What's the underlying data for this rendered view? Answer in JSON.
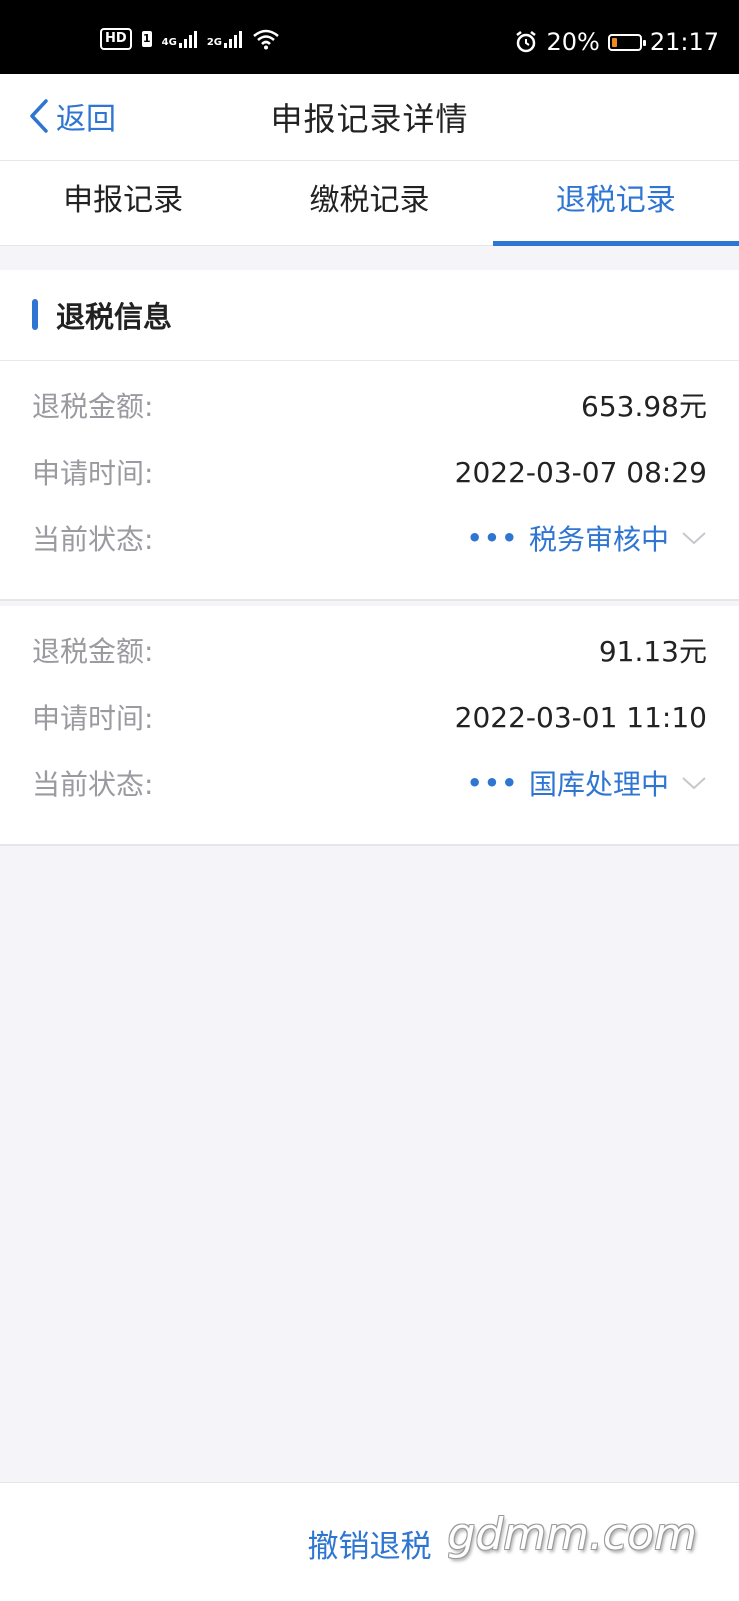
{
  "status_bar": {
    "hd": "HD",
    "sim": "1",
    "net1": "4G",
    "net2": "2G",
    "battery_pct": "20%",
    "battery_level": 0.2,
    "time": "21:17",
    "icons": [
      "alarm-icon",
      "wifi-icon",
      "battery-icon",
      "signal-icon"
    ]
  },
  "nav": {
    "back_label": "返回",
    "title": "申报记录详情"
  },
  "tabs": [
    {
      "label": "申报记录",
      "active": false
    },
    {
      "label": "缴税记录",
      "active": false
    },
    {
      "label": "退税记录",
      "active": true
    }
  ],
  "section": {
    "title": "退税信息"
  },
  "records": [
    {
      "amount_label": "退税金额:",
      "amount": "653.98元",
      "time_label": "申请时间:",
      "time": "2022-03-07 08:29",
      "status_label": "当前状态:",
      "status_dots": "•••",
      "status": "税务审核中"
    },
    {
      "amount_label": "退税金额:",
      "amount": "91.13元",
      "time_label": "申请时间:",
      "time": "2022-03-01 11:10",
      "status_label": "当前状态:",
      "status_dots": "•••",
      "status": "国库处理中"
    }
  ],
  "bottom": {
    "action_label": "撤销退税",
    "watermark": "gdmm.com"
  },
  "colors": {
    "accent": "#2f76d2",
    "background": "#f5f5f9",
    "label": "#9a9aa0",
    "battery": "#f08a24"
  }
}
